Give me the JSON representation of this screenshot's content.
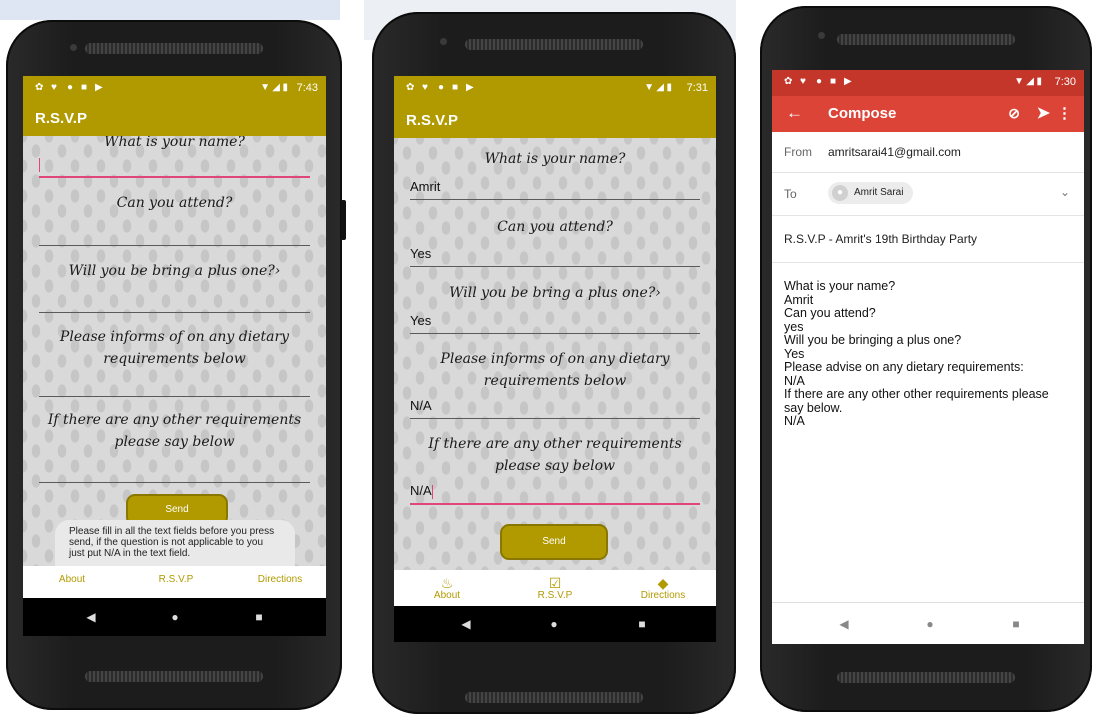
{
  "phone1": {
    "status_time": "7:43",
    "app_title": "R.S.V.P",
    "questions": [
      "What is your name?",
      "Can you attend?",
      "Will you be bring a plus one?›",
      "Please informs of on any dietary requirements below",
      "If there are any other requirements please say below"
    ],
    "send_label": "Send",
    "toast": "Please fill in all the text fields before you press send, if the question is not applicable to you just put N/A in the text field.",
    "nav": [
      "About",
      "R.S.V.P",
      "Directions"
    ]
  },
  "phone2": {
    "status_time": "7:31",
    "app_title": "R.S.V.P",
    "questions": [
      "What is your name?",
      "Can you attend?",
      "Will you be bring a plus one?›",
      "Please informs of on any dietary requirements below",
      "If there are any other requirements please say below"
    ],
    "answers": [
      "Amrit",
      "Yes",
      "Yes",
      "N/A",
      "N/A"
    ],
    "send_label": "Send",
    "nav": [
      "About",
      "R.S.V.P",
      "Directions"
    ]
  },
  "phone3": {
    "status_time": "7:30",
    "toolbar_title": "Compose",
    "from_label": "From",
    "from_value": "amritsarai41@gmail.com",
    "to_label": "To",
    "to_value": "Amrit Sarai",
    "subject": "R.S.V.P - Amrit's 19th Birthday Party",
    "body_lines": [
      "What is your name?",
      "Amrit",
      "Can you attend?",
      "yes",
      "Will you be bringing a plus one?",
      "Yes",
      "Please advise on any dietary requirements:",
      "N/A",
      "If there are any other other requirements please",
      "say below.",
      "N/A"
    ]
  },
  "colors": {
    "olive": "#b19a00",
    "gmail_red": "#db4437",
    "field_accent": "#e0457b"
  },
  "icons": [
    "settings-icon",
    "location-icon",
    "record-icon",
    "sd-card-icon",
    "play-store-icon",
    "wifi-icon",
    "signal-icon",
    "battery-icon",
    "cake-icon",
    "calendar-icon",
    "directions-icon",
    "back-arrow-icon",
    "attach-icon",
    "send-icon",
    "more-icon",
    "chevron-down-icon",
    "back-icon",
    "home-icon",
    "recents-icon"
  ]
}
